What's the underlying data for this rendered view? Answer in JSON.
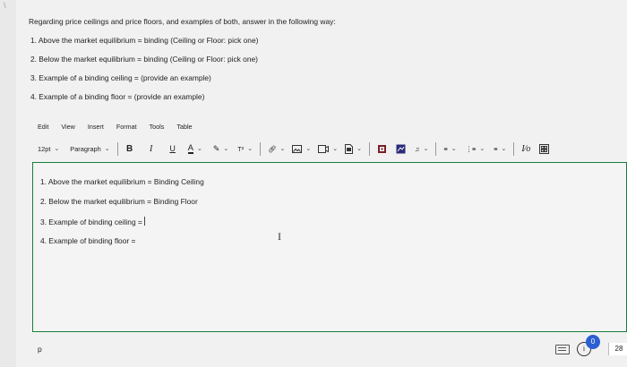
{
  "instructions": {
    "intro": "Regarding price ceilings and price floors, and examples of both, answer in the following way:",
    "items": [
      "1.  Above the market equilibrium = binding (Ceiling or Floor: pick one)",
      "2.  Below the market equilibrium = binding (Ceiling or Floor: pick one)",
      "3.  Example of a binding ceiling = (provide an example)",
      "4.  Example of a binding floor = (provide an example)"
    ]
  },
  "menu": [
    "Edit",
    "View",
    "Insert",
    "Format",
    "Tools",
    "Table"
  ],
  "toolbar": {
    "font_size": "12pt",
    "block_format": "Paragraph",
    "bold": "B",
    "italic": "I",
    "underline": "U",
    "text_color": "A",
    "superscript": "T²",
    "rtl": "I⁄o"
  },
  "editor": {
    "lines": [
      "1. Above the market equilibrium = Binding Ceiling",
      "2. Below the market equilibrium = Binding Floor",
      "3. Example of binding ceiling =",
      "4. Example of binding floor ="
    ]
  },
  "status": {
    "path": "p",
    "notification_count": "0",
    "word_count": "28"
  },
  "colors": {
    "editor_border": "#16803b",
    "notification": "#2c5fd1"
  }
}
